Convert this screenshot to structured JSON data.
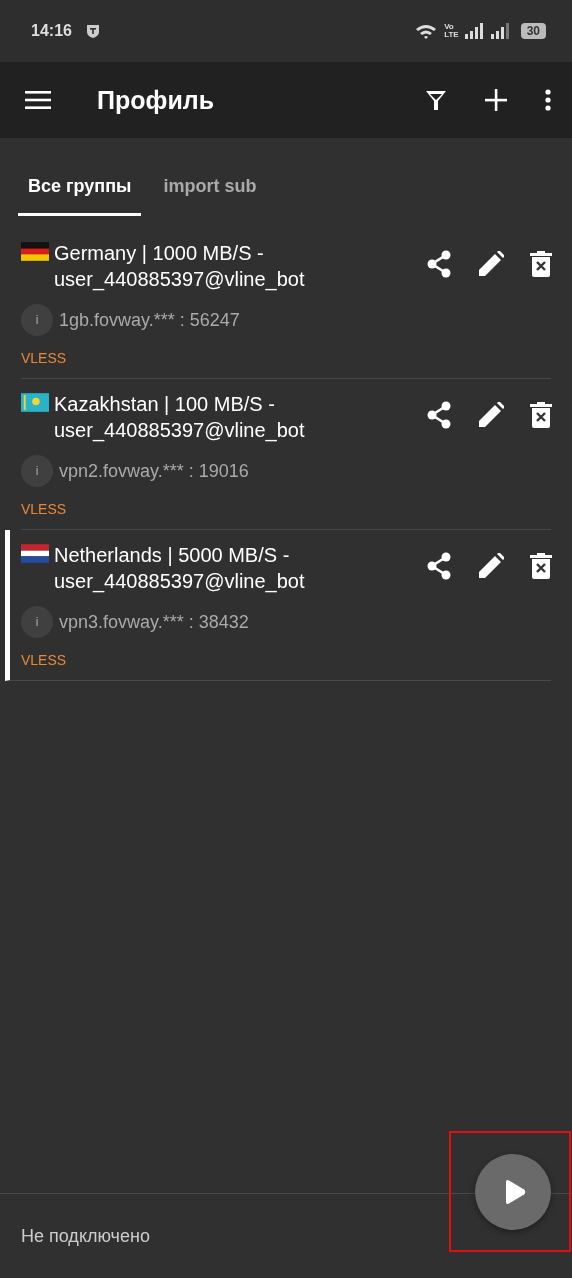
{
  "status_bar": {
    "time": "14:16",
    "network_top": "Vo",
    "network_bottom": "LTE",
    "battery": "30"
  },
  "app_bar": {
    "title": "Профиль"
  },
  "tabs": [
    {
      "label": "Все группы",
      "selected": true
    },
    {
      "label": "import sub",
      "selected": false
    }
  ],
  "servers": [
    {
      "kind": "de",
      "name": "Germany | 1000 MB/S - user_440885397@vline_bot",
      "address": "1gb.fovway.*** : 56247",
      "info_icon": "i",
      "protocol": "VLESS",
      "selected": false
    },
    {
      "kind": "kz",
      "name": "Kazakhstan | 100 MB/S - user_440885397@vline_bot",
      "address": "vpn2.fovway.*** : 19016",
      "info_icon": "i",
      "protocol": "VLESS",
      "selected": false
    },
    {
      "kind": "nl",
      "name": "Netherlands | 5000 MB/S - user_440885397@vline_bot",
      "address": "vpn3.fovway.*** : 38432",
      "info_icon": "i",
      "protocol": "VLESS",
      "selected": true
    }
  ],
  "footer": {
    "status": "Не подключено",
    "connect_button": {
      "highlighted": true
    }
  }
}
